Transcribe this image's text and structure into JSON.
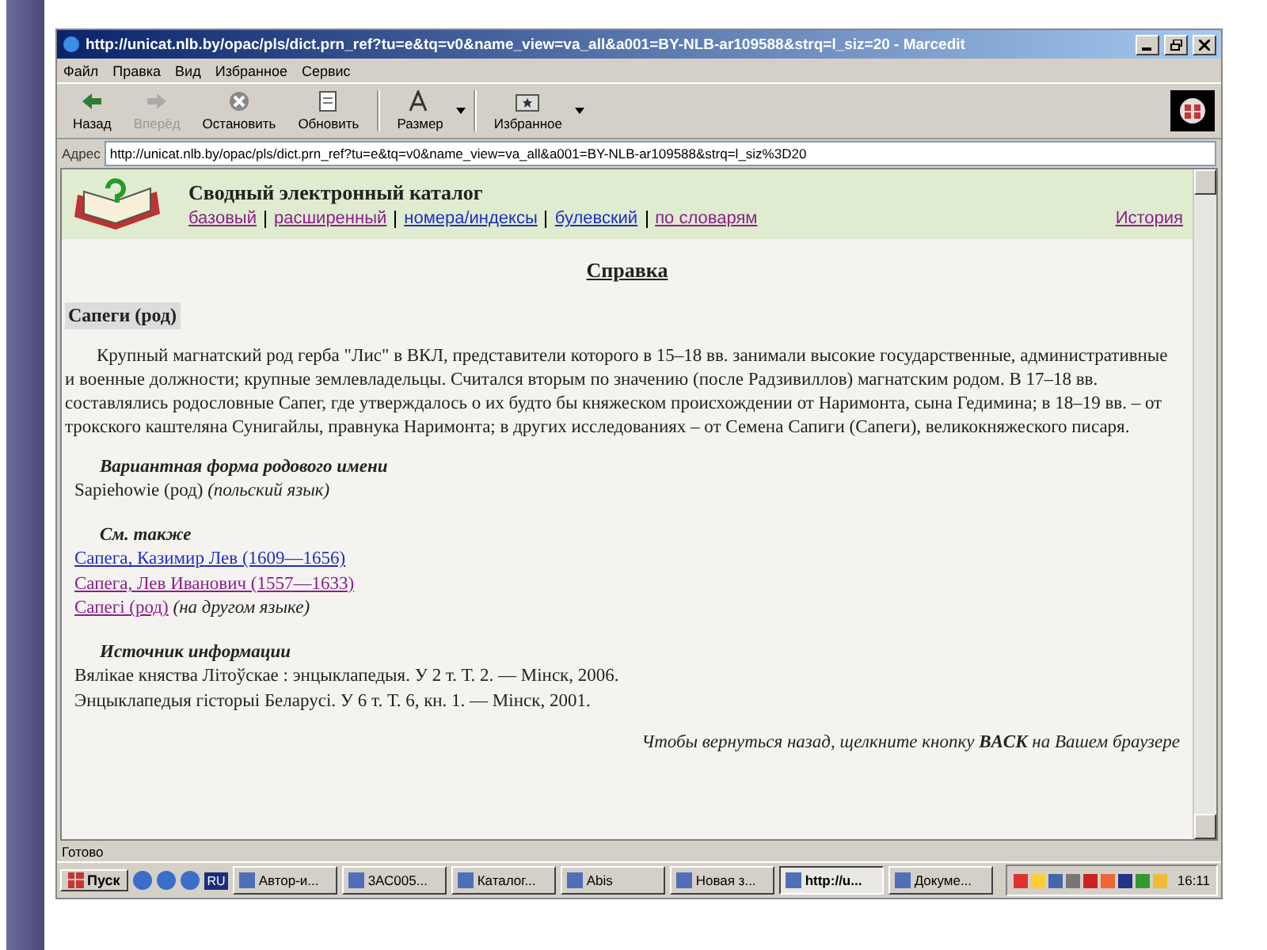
{
  "window": {
    "title": "http://unicat.nlb.by/opac/pls/dict.prn_ref?tu=e&tq=v0&name_view=va_all&a001=BY-NLB-ar109588&strq=l_siz=20 - Marcedit"
  },
  "menu": [
    "Файл",
    "Правка",
    "Вид",
    "Избранное",
    "Сервис"
  ],
  "toolbar": [
    {
      "kind": "back",
      "label": "Назад",
      "disabled": false,
      "dropdown": false
    },
    {
      "kind": "forward",
      "label": "Вперёд",
      "disabled": true,
      "dropdown": false
    },
    {
      "kind": "stop",
      "label": "Остановить",
      "disabled": false,
      "dropdown": false
    },
    {
      "kind": "refresh",
      "label": "Обновить",
      "disabled": false,
      "dropdown": false
    },
    {
      "kind": "size",
      "label": "Размер",
      "disabled": false,
      "dropdown": true
    },
    {
      "kind": "favorites",
      "label": "Избранное",
      "disabled": false,
      "dropdown": true
    }
  ],
  "address": {
    "label": "Адрес",
    "value": "http://unicat.nlb.by/opac/pls/dict.prn_ref?tu=e&tq=v0&name_view=va_all&a001=BY-NLB-ar109588&strq=l_siz%3D20"
  },
  "catalog": {
    "title": "Сводный электронный каталог",
    "links": [
      {
        "label": "базовый",
        "visited": true
      },
      {
        "label": "расширенный",
        "visited": true
      },
      {
        "label": "номера/индексы",
        "visited": false
      },
      {
        "label": "булевский",
        "visited": false
      },
      {
        "label": "по словарям",
        "visited": true
      }
    ],
    "history": {
      "label": "История",
      "visited": true
    }
  },
  "page": {
    "heading": "Справка",
    "entry": "Сапеги (род)",
    "description": "Крупный магнатский род герба \"Лис\" в ВКЛ, представители которого в 15–18 вв. занимали высокие государственные, административные и военные должности; крупные землевладельцы. Считался вторым по значению (после Радзивиллов) магнатским родом. В 17–18 вв. составлялись родословные Сапег, где утверждалось о их будто бы княжеском происхождении от Наримонта, сына Гедимина; в 18–19 вв. – от трокского каштеляна Сунигайлы, правнука Наримонта; в других исследованиях – от Семена Сапиги (Сапеги), великокняжеского писаря.",
    "sections": [
      {
        "kind": "text",
        "title": "Вариантная форма родового имени",
        "lines": [
          {
            "text": "Sapiehowie (род)",
            "note": "(польский язык)"
          }
        ]
      },
      {
        "kind": "links",
        "title": "См. также",
        "lines": [
          {
            "text": "Сапега, Казимир Лев (1609—1656)",
            "visited": false
          },
          {
            "text": "Сапега, Лев Иванович (1557—1633)",
            "visited": true
          },
          {
            "text": "Сапегі (род)",
            "visited": true,
            "note": "(на другом языке)"
          }
        ]
      },
      {
        "kind": "text",
        "title": "Источник информации",
        "lines": [
          {
            "text": "Вялікае княства Літоўскае : энцыклапедыя. У 2 т. Т. 2. — Мінск, 2006."
          },
          {
            "text": "Энцыклапедыя гісторыі Беларусі. У 6 т. Т. 6, кн. 1. — Мінск, 2001."
          }
        ]
      }
    ],
    "footer": "Чтобы вернуться назад, щелкните кнопку **BACK** на  Вашем браузере"
  },
  "status_bar": "Готово",
  "taskbar": {
    "start": "Пуск",
    "language": "RU",
    "tasks": [
      {
        "label": "Автор-и...",
        "selected": false
      },
      {
        "label": "3АС005...",
        "selected": false
      },
      {
        "label": "Каталог...",
        "selected": false
      },
      {
        "label": "Abis",
        "selected": false
      },
      {
        "label": "Новая з...",
        "selected": false
      },
      {
        "label": "http://u...",
        "selected": true
      },
      {
        "label": "Докуме...",
        "selected": false
      }
    ],
    "clock": "16:11"
  }
}
